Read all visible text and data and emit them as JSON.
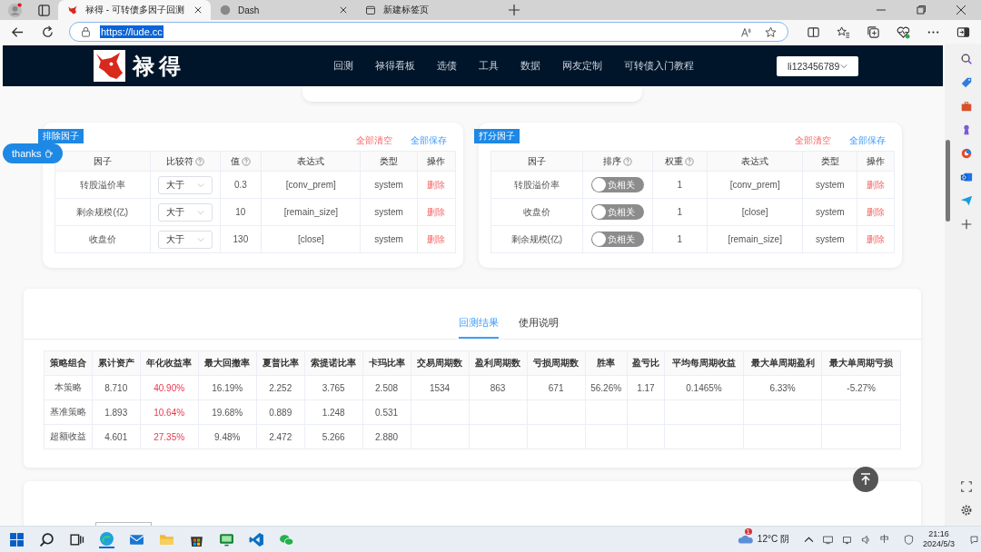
{
  "browser": {
    "tabs": [
      {
        "title": "禄得 - 可转债多因子回测",
        "selected": true
      },
      {
        "title": "Dash",
        "selected": false
      },
      {
        "title": "新建标签页",
        "selected": false
      }
    ],
    "address": "https://lude.cc"
  },
  "site": {
    "logo_text": "禄得",
    "nav": [
      "回测",
      "禄得看板",
      "选债",
      "工具",
      "数据",
      "网友定制",
      "可转债入门教程"
    ],
    "user": "li123456789"
  },
  "thanks_button": "thanks",
  "panels": [
    {
      "kind": "filter",
      "tag": "排除因子",
      "clear": "全部清空",
      "save": "全部保存",
      "columns": [
        {
          "label": "因子",
          "help": false
        },
        {
          "label": "比较符",
          "help": true
        },
        {
          "label": "值",
          "help": true
        },
        {
          "label": "表达式",
          "help": false
        },
        {
          "label": "类型",
          "help": false
        },
        {
          "label": "操作",
          "help": false
        }
      ],
      "rows": [
        {
          "factor": "转股溢价率",
          "operator": "大于",
          "value": "0.3",
          "expression": "[conv_prem]",
          "type": "system",
          "action": "删除"
        },
        {
          "factor": "剩余规模(亿)",
          "operator": "大于",
          "value": "10",
          "expression": "[remain_size]",
          "type": "system",
          "action": "删除"
        },
        {
          "factor": "收盘价",
          "operator": "大于",
          "value": "130",
          "expression": "[close]",
          "type": "system",
          "action": "删除"
        }
      ]
    },
    {
      "kind": "score",
      "tag": "打分因子",
      "clear": "全部清空",
      "save": "全部保存",
      "columns": [
        {
          "label": "因子",
          "help": false
        },
        {
          "label": "排序",
          "help": true
        },
        {
          "label": "权重",
          "help": true
        },
        {
          "label": "表达式",
          "help": false
        },
        {
          "label": "类型",
          "help": false
        },
        {
          "label": "操作",
          "help": false
        }
      ],
      "rows": [
        {
          "factor": "转股溢价率",
          "toggle": {
            "label": "负相关",
            "on": false
          },
          "value": "1",
          "expression": "[conv_prem]",
          "type": "system",
          "action": "删除"
        },
        {
          "factor": "收盘价",
          "toggle": {
            "label": "负相关",
            "on": false
          },
          "value": "1",
          "expression": "[close]",
          "type": "system",
          "action": "删除"
        },
        {
          "factor": "剩余规模(亿)",
          "toggle": {
            "label": "负相关",
            "on": false
          },
          "value": "1",
          "expression": "[remain_size]",
          "type": "system",
          "action": "删除"
        }
      ]
    }
  ],
  "results": {
    "tabs": [
      {
        "label": "回测结果",
        "selected": true
      },
      {
        "label": "使用说明",
        "selected": false
      }
    ],
    "columns": [
      {
        "label": "策略组合",
        "kind": "plain"
      },
      {
        "label": "累计资产",
        "kind": "plain"
      },
      {
        "label": "年化收益率",
        "kind": "highlight"
      },
      {
        "label": "最大回撤率",
        "kind": "plain"
      },
      {
        "label": "夏普比率",
        "kind": "plain"
      },
      {
        "label": "索提诺比率",
        "kind": "plain"
      },
      {
        "label": "卡玛比率",
        "kind": "plain"
      },
      {
        "label": "交易周期数",
        "kind": "plain"
      },
      {
        "label": "盈利周期数",
        "kind": "plain"
      },
      {
        "label": "亏损周期数",
        "kind": "plain"
      },
      {
        "label": "胜率",
        "kind": "plain"
      },
      {
        "label": "盈亏比",
        "kind": "plain"
      },
      {
        "label": "平均每周期收益",
        "kind": "plain"
      },
      {
        "label": "最大单周期盈利",
        "kind": "plain"
      },
      {
        "label": "最大单周期亏损",
        "kind": "plain"
      }
    ],
    "rows": [
      [
        "本策略",
        "8.710",
        "40.90%",
        "16.19%",
        "2.252",
        "3.765",
        "2.508",
        "1534",
        "863",
        "671",
        "56.26%",
        "1.17",
        "0.1465%",
        "6.33%",
        "-5.27%"
      ],
      [
        "基准策略",
        "1.893",
        "10.64%",
        "19.68%",
        "0.889",
        "1.248",
        "0.531"
      ],
      [
        "超额收益",
        "4.601",
        "27.35%",
        "9.48%",
        "2.472",
        "5.266",
        "2.880"
      ]
    ]
  },
  "taskbar": {
    "weather": "12°C 阴",
    "weather_badge": "1",
    "ime": "中",
    "time": "21:16",
    "date": "2024/5/3"
  }
}
